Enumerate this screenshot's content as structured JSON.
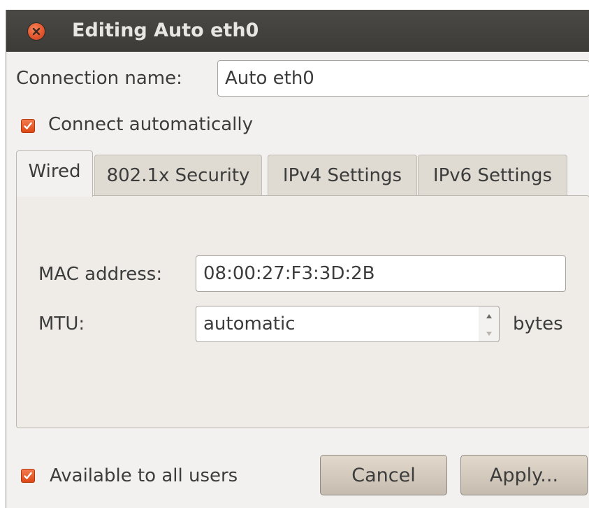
{
  "window": {
    "title": "Editing Auto eth0"
  },
  "connection": {
    "name_label": "Connection name:",
    "name_value": "Auto eth0",
    "connect_auto_label": "Connect automatically",
    "connect_auto_checked": true
  },
  "tabs": [
    {
      "label": "Wired",
      "active": true
    },
    {
      "label": "802.1x Security",
      "active": false
    },
    {
      "label": "IPv4 Settings",
      "active": false
    },
    {
      "label": "IPv6 Settings",
      "active": false
    }
  ],
  "wired": {
    "mac_label": "MAC address:",
    "mac_value": "08:00:27:F3:3D:2B",
    "mtu_label": "MTU:",
    "mtu_value": "automatic",
    "mtu_unit": "bytes"
  },
  "footer": {
    "all_users_label": "Available to all users",
    "all_users_checked": true,
    "cancel_label": "Cancel",
    "apply_label": "Apply..."
  },
  "colors": {
    "titlebar": "#3c3b37",
    "window_bg": "#f2f1f0",
    "accent": "#dd4814"
  },
  "icons": {
    "close": "close-icon",
    "check": "check-icon",
    "spin_up": "triangle-up-icon",
    "spin_down": "triangle-down-icon"
  }
}
